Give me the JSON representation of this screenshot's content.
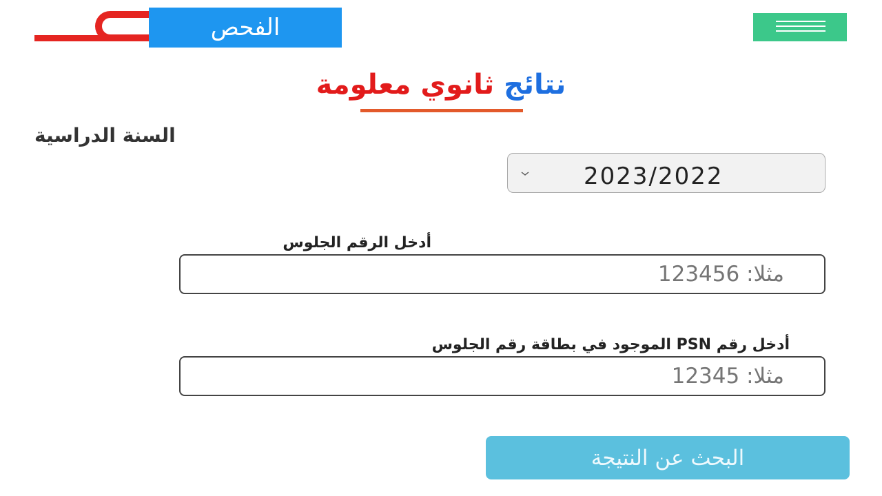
{
  "header": {
    "logo_text": "الفحص",
    "logo_color": "#e52521",
    "logo_box_color": "#1e96f0",
    "menu_icon": "hamburger-icon",
    "menu_button_color": "#3cc88a"
  },
  "title": {
    "part1": "نتائج",
    "part2": "ثانوي معلومة",
    "part1_color": "#1e6fe0",
    "part2_color": "#e21b1b",
    "underline_color": "#e35a2b"
  },
  "year": {
    "label": "السنة الدراسية",
    "selected": "2023/2022",
    "icon": "chevron-down-icon"
  },
  "seat_number": {
    "label": "أدخل الرقم الجلوس",
    "placeholder": "مثلا: 123456",
    "value": ""
  },
  "psn": {
    "label": "أدخل رقم PSN الموجود في بطاقة رقم الجلوس",
    "placeholder": "مثلا: 12345",
    "value": ""
  },
  "search_button": {
    "label": "البحث عن النتيجة",
    "color": "#5bc0de"
  }
}
